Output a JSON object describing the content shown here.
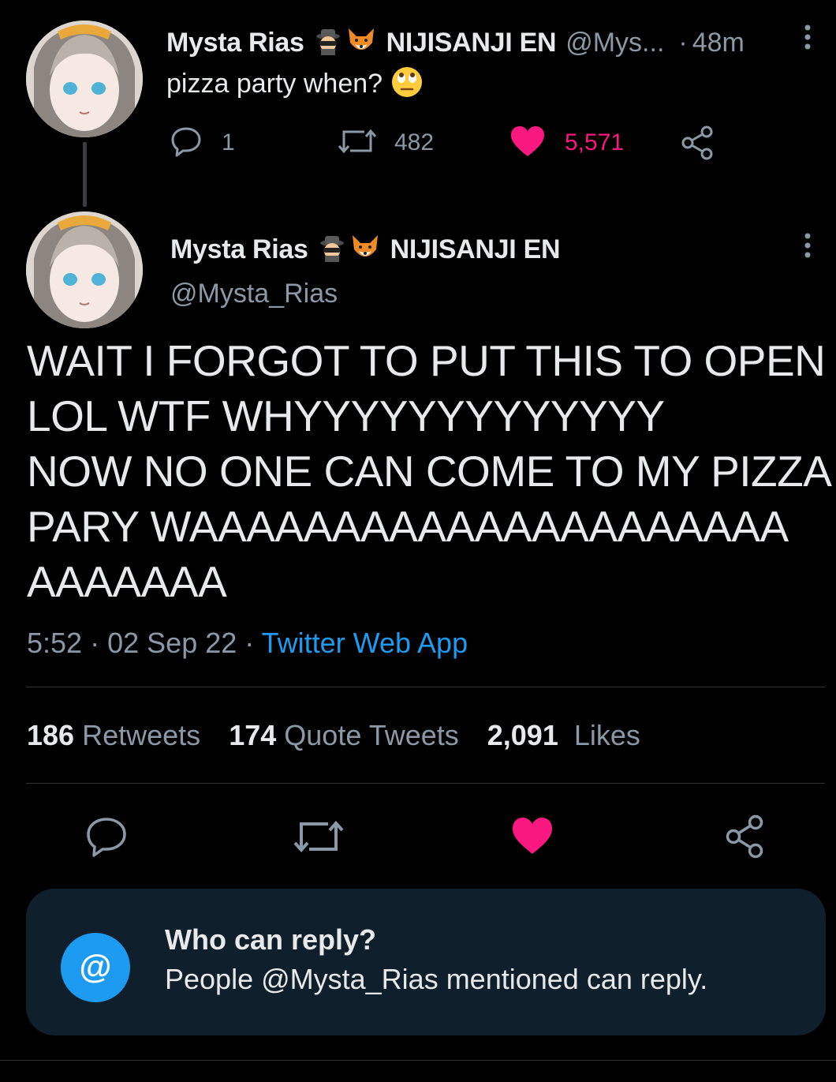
{
  "parent_tweet": {
    "display_name": "Mysta Rias",
    "affiliation": "NIJISANJI EN",
    "handle": "@Mys...",
    "separator": "·",
    "time": "48m",
    "text": "pizza party when?",
    "text_emoji_icon": "rolling-eyes-emoji-icon",
    "reply_count": "1",
    "retweet_count": "482",
    "like_count": "5,571",
    "liked": true
  },
  "main_tweet": {
    "display_name": "Mysta Rias",
    "affiliation": "NIJISANJI EN",
    "handle": "@Mysta_Rias",
    "text_lines": [
      "WAIT I FORGOT TO PUT THIS TO OPEN",
      "LOL WTF WHYYYYYYYYYYYYY",
      "NOW NO ONE CAN COME TO MY PIZZA",
      "PARY WAAAAAAAAAAAAAAAAAAAAA",
      "AAAAAAA"
    ],
    "time": "5:52",
    "sep1": "·",
    "date": "02 Sep 22",
    "sep2": "·",
    "source": "Twitter Web App",
    "stats": {
      "retweets_value": "186",
      "retweets_label": "Retweets",
      "quotes_value": "174",
      "quotes_label": "Quote Tweets",
      "likes_value": "2,091",
      "likes_label": "Likes"
    }
  },
  "reply_restriction": {
    "title": "Who can reply?",
    "subtitle": "People @Mysta_Rias mentioned can reply.",
    "icon_symbol": "@"
  },
  "colors": {
    "background": "#000000",
    "text_primary": "#e7e9ea",
    "text_muted": "#8b98a5",
    "like_pink": "#f91880",
    "accent_blue": "#1d9bf0",
    "reply_box_bg": "#0f1f2b"
  }
}
